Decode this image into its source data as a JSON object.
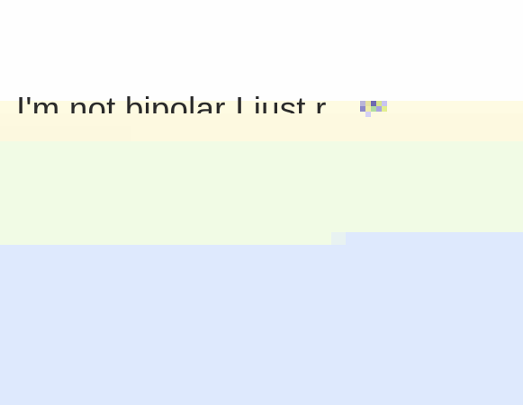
{
  "caption": {
    "text": "I'm not bipolar I just r"
  },
  "colors": {
    "background": "#ffffff",
    "text": "#2a2a2a",
    "yellow_band": "#fefbe2",
    "green_band": "#f1fbe5",
    "blue_band": "#dee9fd"
  }
}
